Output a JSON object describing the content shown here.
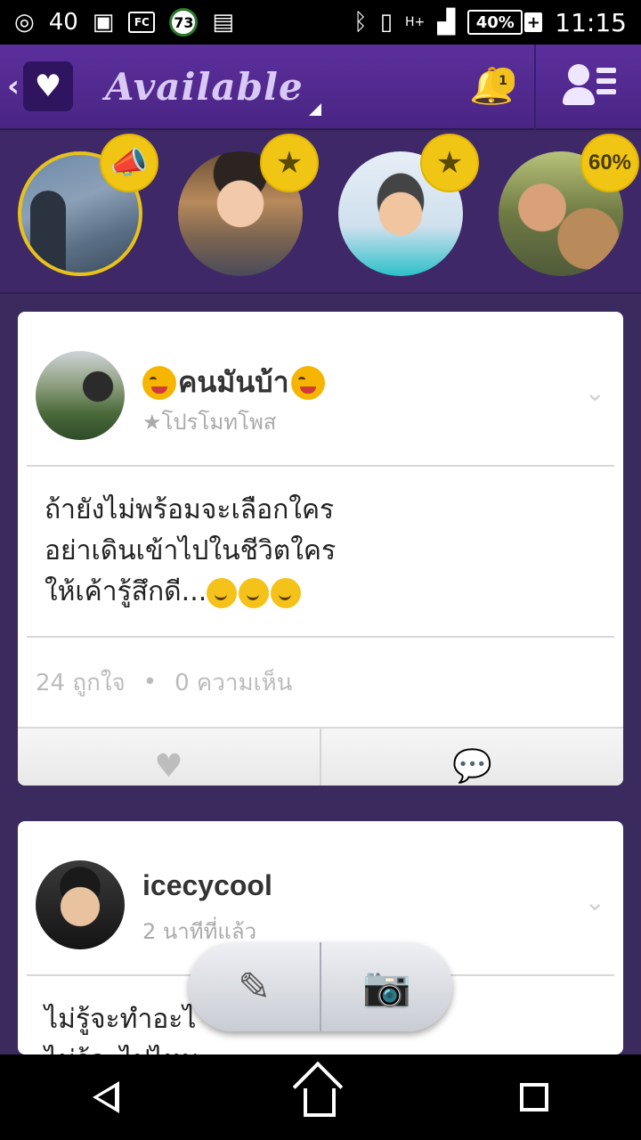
{
  "status_bar": {
    "left_count": "40",
    "box_label": "FC",
    "badge_number": "73",
    "network": "H+",
    "battery": "40%",
    "charging_symbol": "+",
    "time": "11:15"
  },
  "app_bar": {
    "status_label": "Available",
    "notification_count": "1"
  },
  "stories": [
    {
      "badge": "megaphone-icon"
    },
    {
      "badge": "star-icon"
    },
    {
      "badge": "star-icon"
    },
    {
      "badge_text": "60%"
    }
  ],
  "posts": [
    {
      "author": "คนมันบ้า",
      "subtitle": "★โปรโมทโพส",
      "body_lines": [
        "ถ้ายังไม่พร้อมจะเลือกใคร",
        "อย่าเดินเข้าไปในชีวิตใคร",
        "ให้เค้ารู้สึกดี..."
      ],
      "likes": "24 ถูกใจ",
      "comments": "0 ความเห็น"
    },
    {
      "author": "icecycool",
      "subtitle": "2 นาทีที่แล้ว",
      "body_lines": [
        "ไม่รู้จะทำอะไ",
        "ไม่รู้จะไปไหน"
      ]
    }
  ],
  "icons": {
    "back": "chevron-left-icon",
    "logo": "heart-icon",
    "notifications": "bell-icon",
    "contacts": "contacts-list-icon",
    "post_menu": "chevron-down-icon",
    "like": "heart-icon",
    "comment": "speech-bubbles-icon",
    "compose": "edit-icon",
    "camera": "camera-icon"
  },
  "colors": {
    "app_bar": "#5b2f9c",
    "background": "#3a2a5e",
    "badge_gold": "#f0c514"
  }
}
